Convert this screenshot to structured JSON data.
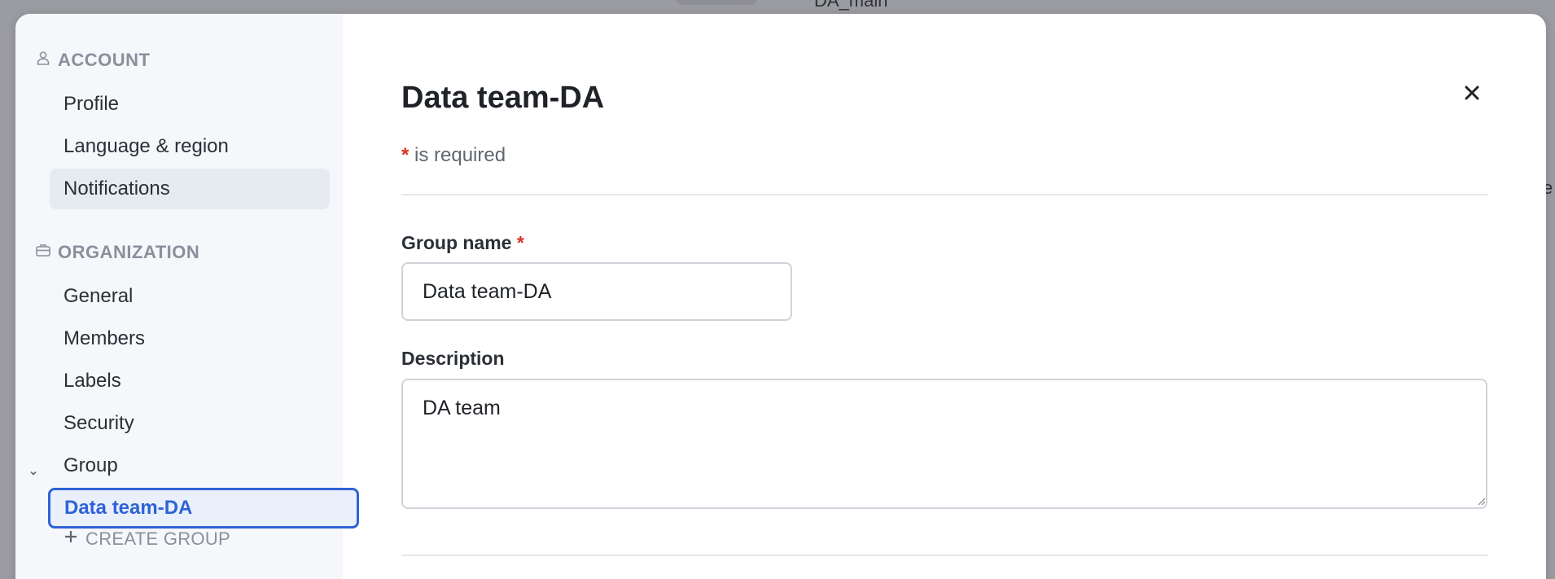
{
  "background": {
    "top_text": "DA_main",
    "edge_text": "e"
  },
  "sidebar": {
    "account_title": "ACCOUNT",
    "account_items": [
      {
        "label": "Profile"
      },
      {
        "label": "Language & region"
      },
      {
        "label": "Notifications"
      }
    ],
    "organization_title": "ORGANIZATION",
    "organization_items": [
      {
        "label": "General"
      },
      {
        "label": "Members"
      },
      {
        "label": "Labels"
      },
      {
        "label": "Security"
      },
      {
        "label": "Group"
      }
    ],
    "group_children": [
      {
        "label": "Data team-DA"
      }
    ],
    "create_group_label": "CREATE GROUP"
  },
  "form": {
    "title": "Data team-DA",
    "required_star": "*",
    "required_note": "is required",
    "group_name_label": "Group name",
    "group_name_value": "Data team-DA",
    "description_label": "Description",
    "description_value": "DA team"
  },
  "colors": {
    "accent": "#2f62d6",
    "required": "#d93025",
    "sidebar_bg": "#f5f7fa"
  },
  "icons": {
    "account": "user-icon",
    "organization": "briefcase-icon",
    "close": "close-icon",
    "group_toggle": "chevron-down-icon",
    "create_group": "plus-icon"
  }
}
